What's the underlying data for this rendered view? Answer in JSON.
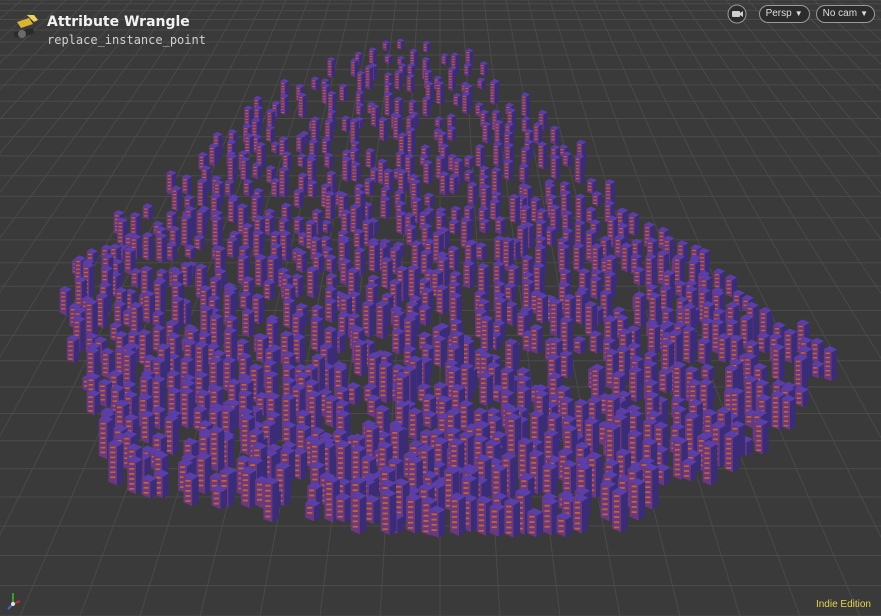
{
  "node": {
    "title": "Attribute Wrangle",
    "path": "replace_instance_point",
    "icon": "wrangle-node-icon"
  },
  "viewport": {
    "camera_icon": "camera-lock-icon",
    "projection": "Persp",
    "camera": "No cam"
  },
  "edition": "Indie Edition",
  "colors": {
    "background": "#3a3a3a",
    "grid": "#4a4a4a",
    "building_top": "#5a3fa8",
    "building_left": "#6a3880",
    "building_right": "#3b2c78",
    "window": "#d8701f",
    "edition_text": "#e8d44d"
  }
}
